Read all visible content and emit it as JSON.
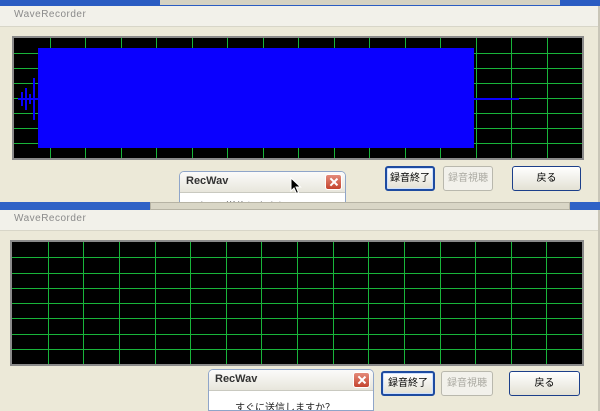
{
  "windows": [
    {
      "title": "WaveRecorder",
      "buttons": {
        "stop_record": "録音終了",
        "listen_record": "録音視聴",
        "back": "戻る"
      },
      "scope": {
        "state": "recording",
        "wave_color": "#0a00ff",
        "grid_color": "#18b43a"
      },
      "dialog": {
        "title": "RecWav",
        "message": "すぐに送信しますか？"
      }
    },
    {
      "title": "WaveRecorder",
      "buttons": {
        "stop_record": "録音終了",
        "listen_record": "録音視聴",
        "back": "戻る"
      },
      "scope": {
        "state": "idle",
        "grid_color": "#18b43a"
      },
      "dialog": {
        "title": "RecWav",
        "message": "すぐに送信しますか？"
      }
    }
  ],
  "icons": {
    "cursor": "arrow-cursor-icon",
    "close": "close-icon"
  }
}
